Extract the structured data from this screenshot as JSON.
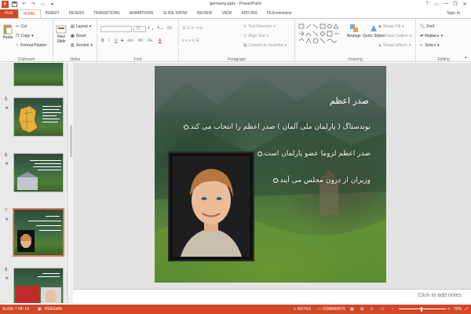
{
  "window": {
    "title": "germany.pptx - PowerPoint",
    "controls": [
      "?",
      "▭",
      "—",
      "❐",
      "✕"
    ],
    "app_icon": "P"
  },
  "tabs": [
    "FILE",
    "HOME",
    "INSERT",
    "DESIGN",
    "TRANSITIONS",
    "ANIMATIONS",
    "SLIDE SHOW",
    "REVIEW",
    "VIEW",
    "ADD-INS",
    "FILEminimizer"
  ],
  "active_tab": "HOME",
  "signin": "Sign in",
  "ribbon": {
    "clipboard": {
      "paste": "Paste",
      "cut": "Cut",
      "copy": "Copy",
      "format_painter": "Format Painter",
      "label": "Clipboard"
    },
    "slides": {
      "new_slide": "New",
      "new_slide2": "Slide",
      "layout": "Layout",
      "reset": "Reset",
      "section": "Section",
      "label": "Slides"
    },
    "font": {
      "font_size": "72",
      "label": "Font",
      "bold": "B",
      "italic": "I",
      "underline": "U",
      "strike": "S",
      "abc": "abc",
      "av": "AV",
      "aa": "Aa",
      "color_a": "A"
    },
    "paragraph": {
      "text_direction": "Text Direction",
      "align_text": "Align Text",
      "convert_smartart": "Convert to SmartArt",
      "label": "Paragraph"
    },
    "drawing": {
      "arrange": "Arrange",
      "quick_styles": "Quick Styles",
      "shape_fill": "Shape Fill",
      "shape_outline": "Shape Outline",
      "shape_effects": "Shape Effects",
      "label": "Drawing"
    },
    "editing": {
      "find": "Find",
      "replace": "Replace",
      "select": "Select",
      "label": "Editing"
    }
  },
  "thumbnails": [
    {
      "num": "",
      "lines": []
    },
    {
      "num": "5",
      "lines": []
    },
    {
      "num": "6",
      "lines": []
    },
    {
      "num": "7",
      "lines": []
    },
    {
      "num": "8",
      "lines": []
    }
  ],
  "slide": {
    "title": "صدر اعظم",
    "bullets": [
      "بوندستاگ ( پارلمان ملی آلمان ) صدر اعظم را انتخاب می کند.",
      "صدر اعظم لزوما عضو پارلمان است.",
      "وزیران از درون مجلس می آیند."
    ]
  },
  "notes_placeholder": "Click to add notes",
  "statusbar": {
    "slide_counter": "SLIDE 7 OF 14",
    "language": "PERSIAN",
    "notes": "NOTES",
    "comments": "COMMENTS",
    "zoom": "70%"
  },
  "colors": {
    "accent": "#d24726",
    "active_thumb": "#e37b54"
  }
}
